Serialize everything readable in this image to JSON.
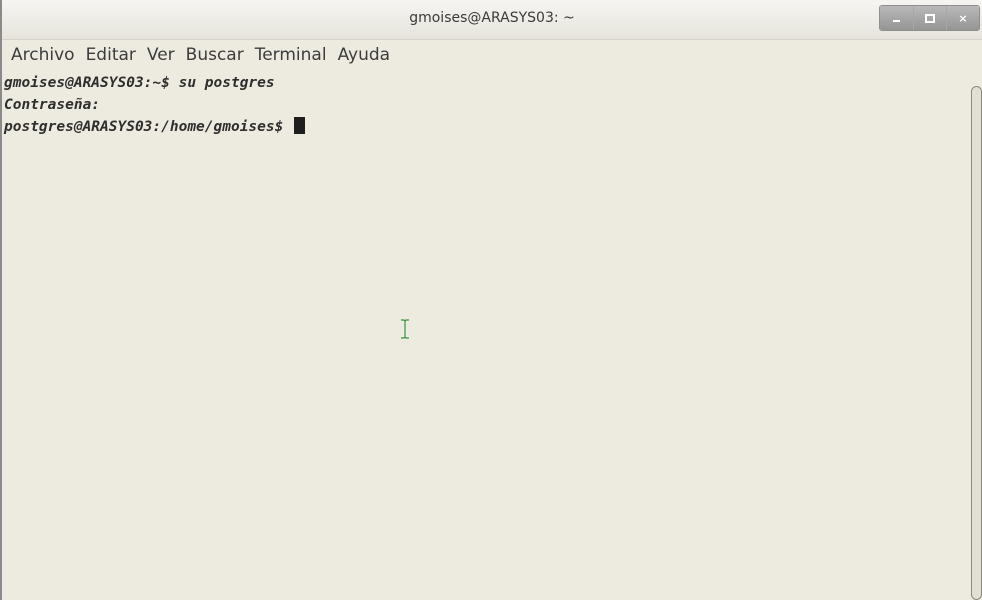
{
  "window": {
    "title": "gmoises@ARASYS03: ~"
  },
  "window_controls": {
    "minimize_icon": "minimize-icon",
    "maximize_icon": "maximize-icon",
    "close_icon": "close-icon",
    "close_glyph": "×"
  },
  "menubar": {
    "items": [
      {
        "label": "Archivo"
      },
      {
        "label": "Editar"
      },
      {
        "label": "Ver"
      },
      {
        "label": "Buscar"
      },
      {
        "label": "Terminal"
      },
      {
        "label": "Ayuda"
      }
    ]
  },
  "terminal": {
    "lines": [
      {
        "text": "gmoises@ARASYS03:~$ su postgres"
      },
      {
        "text": "Contraseña:"
      },
      {
        "text": "postgres@ARASYS03:/home/gmoises$ "
      }
    ],
    "cursor_icon": "text-cursor-block",
    "mouse_pointer_icon": "ibeam-cursor-icon"
  },
  "colors": {
    "background": "#edebe0",
    "text": "#2e2e2e",
    "ibeam": "#3c8a3c"
  }
}
